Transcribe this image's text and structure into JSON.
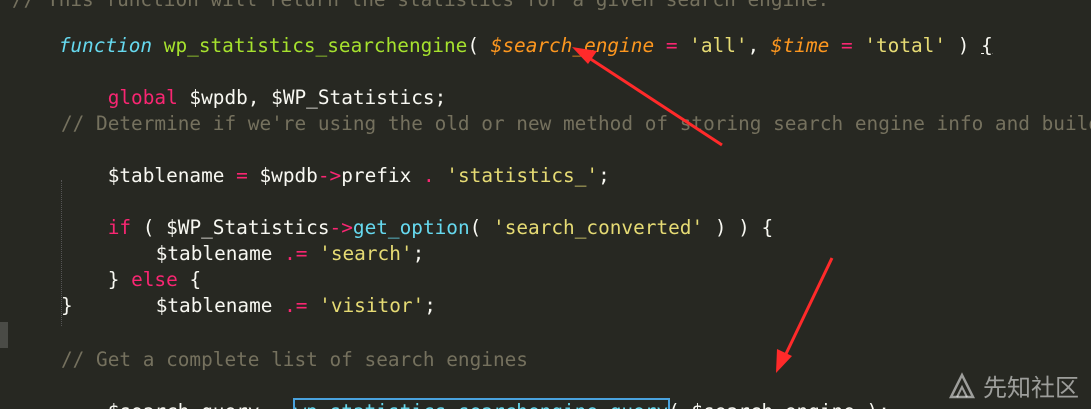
{
  "code": {
    "line0_comment": "// This function will return the statistics for a given search engine.",
    "line1": {
      "kw": "function",
      "name": "wp_statistics_searchengine",
      "open": "( ",
      "p1": "$search_engine",
      "eq1": " = ",
      "v1": "'all'",
      "comma": ", ",
      "p2": "$time",
      "eq2": " = ",
      "v2": "'total'",
      "close": " ) ",
      "brace": "{"
    },
    "line2": {
      "kw": "global",
      "rest": " $wpdb, $WP_Statistics;"
    },
    "line3_comment": "// Determine if we're using the old or new method of storing search engine info and build the",
    "line4": {
      "var": "$tablename",
      "eq": " = ",
      "var2": "$wpdb",
      "arrow": "->",
      "prop": "prefix",
      "dot": " . ",
      "str": "'statistics_'",
      "end": ";"
    },
    "line5": {
      "kw": "if",
      "open": " ( ",
      "var": "$WP_Statistics",
      "arrow": "->",
      "fn": "get_option",
      "p": "( ",
      "str": "'search_converted'",
      "close": " ) ) {"
    },
    "line6": {
      "var": "$tablename",
      "op": " .= ",
      "str": "'search'",
      "end": ";"
    },
    "line7": {
      "b1": "} ",
      "kw": "else",
      "b2": " {"
    },
    "line8": {
      "var": "$tablename",
      "op": " .= ",
      "str": "'visitor'",
      "end": ";"
    },
    "line9": "}",
    "line10_comment": "// Get a complete list of search engines",
    "line11": {
      "var": "$search_query",
      "eq": " = ",
      "fn": "wp_statistics_searchengine_query",
      "args": "( $search_engine );"
    }
  },
  "watermark": {
    "text": "先知社区"
  },
  "colors": {
    "arrow": "#ff2a2a",
    "background": "#272822"
  }
}
